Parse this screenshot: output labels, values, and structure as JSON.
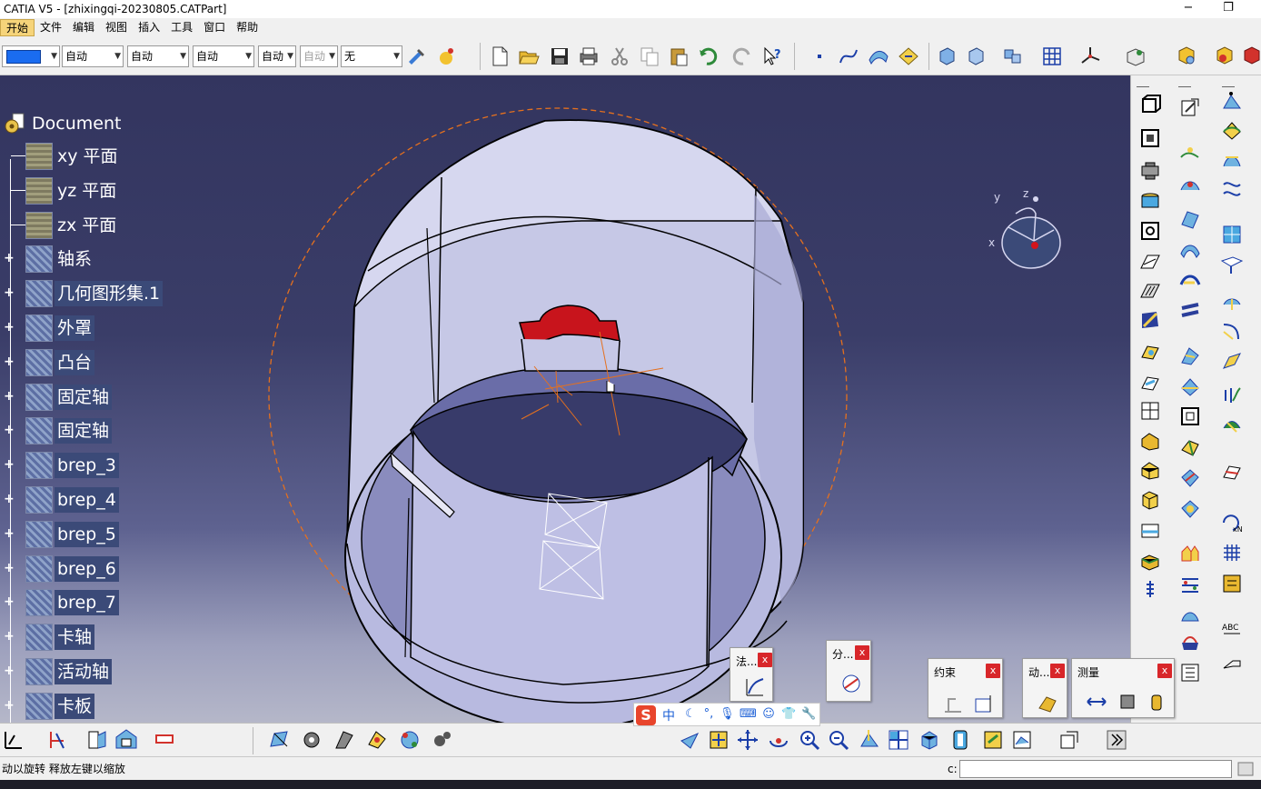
{
  "window": {
    "title": "CATIA V5 - [zhixingqi-20230805.CATPart]",
    "minimize": "−",
    "restore": "❐"
  },
  "menu": [
    "开始",
    "文件",
    "编辑",
    "视图",
    "插入",
    "工具",
    "窗口",
    "帮助"
  ],
  "toolbar": {
    "combos": [
      {
        "value": "自动"
      },
      {
        "value": "自动"
      },
      {
        "value": "自动"
      },
      {
        "value": "自动"
      },
      {
        "value": "自动"
      },
      {
        "value": "无"
      }
    ],
    "color_swatch": "#1a6cf0"
  },
  "tree": {
    "root": "Document",
    "items": [
      {
        "label": "xy 平面",
        "expandable": false
      },
      {
        "label": "yz 平面",
        "expandable": false
      },
      {
        "label": "zx 平面",
        "expandable": false
      },
      {
        "label": "轴系",
        "expandable": true
      },
      {
        "label": "几何图形集.1",
        "expandable": true
      },
      {
        "label": "外罩",
        "expandable": true
      },
      {
        "label": "凸台",
        "expandable": true
      },
      {
        "label": "固定轴",
        "expandable": true
      },
      {
        "label": "固定轴",
        "expandable": true
      },
      {
        "label": "brep_3",
        "expandable": true
      },
      {
        "label": "brep_4",
        "expandable": true
      },
      {
        "label": "brep_5",
        "expandable": true
      },
      {
        "label": "brep_6",
        "expandable": true
      },
      {
        "label": "brep_7",
        "expandable": true
      },
      {
        "label": "卡轴",
        "expandable": true
      },
      {
        "label": "活动轴",
        "expandable": true
      },
      {
        "label": "卡板",
        "expandable": true
      }
    ]
  },
  "compass": {
    "x": "x",
    "y": "y",
    "z": "z"
  },
  "float_toolbars": [
    {
      "title": "法..."
    },
    {
      "title": "分..."
    },
    {
      "title": "约束"
    },
    {
      "title": "动..."
    },
    {
      "title": "测量"
    }
  ],
  "float_close": "x",
  "ime": {
    "logo": "S",
    "lang": "中"
  },
  "status": {
    "text": "动以旋转  释放左键以缩放",
    "cmd_label": "c:"
  },
  "colors": {
    "viewport_top": "#33355f",
    "part_face": "#c9cbea",
    "highlight_red": "#c8141c",
    "axis_orange": "#e5701e"
  }
}
